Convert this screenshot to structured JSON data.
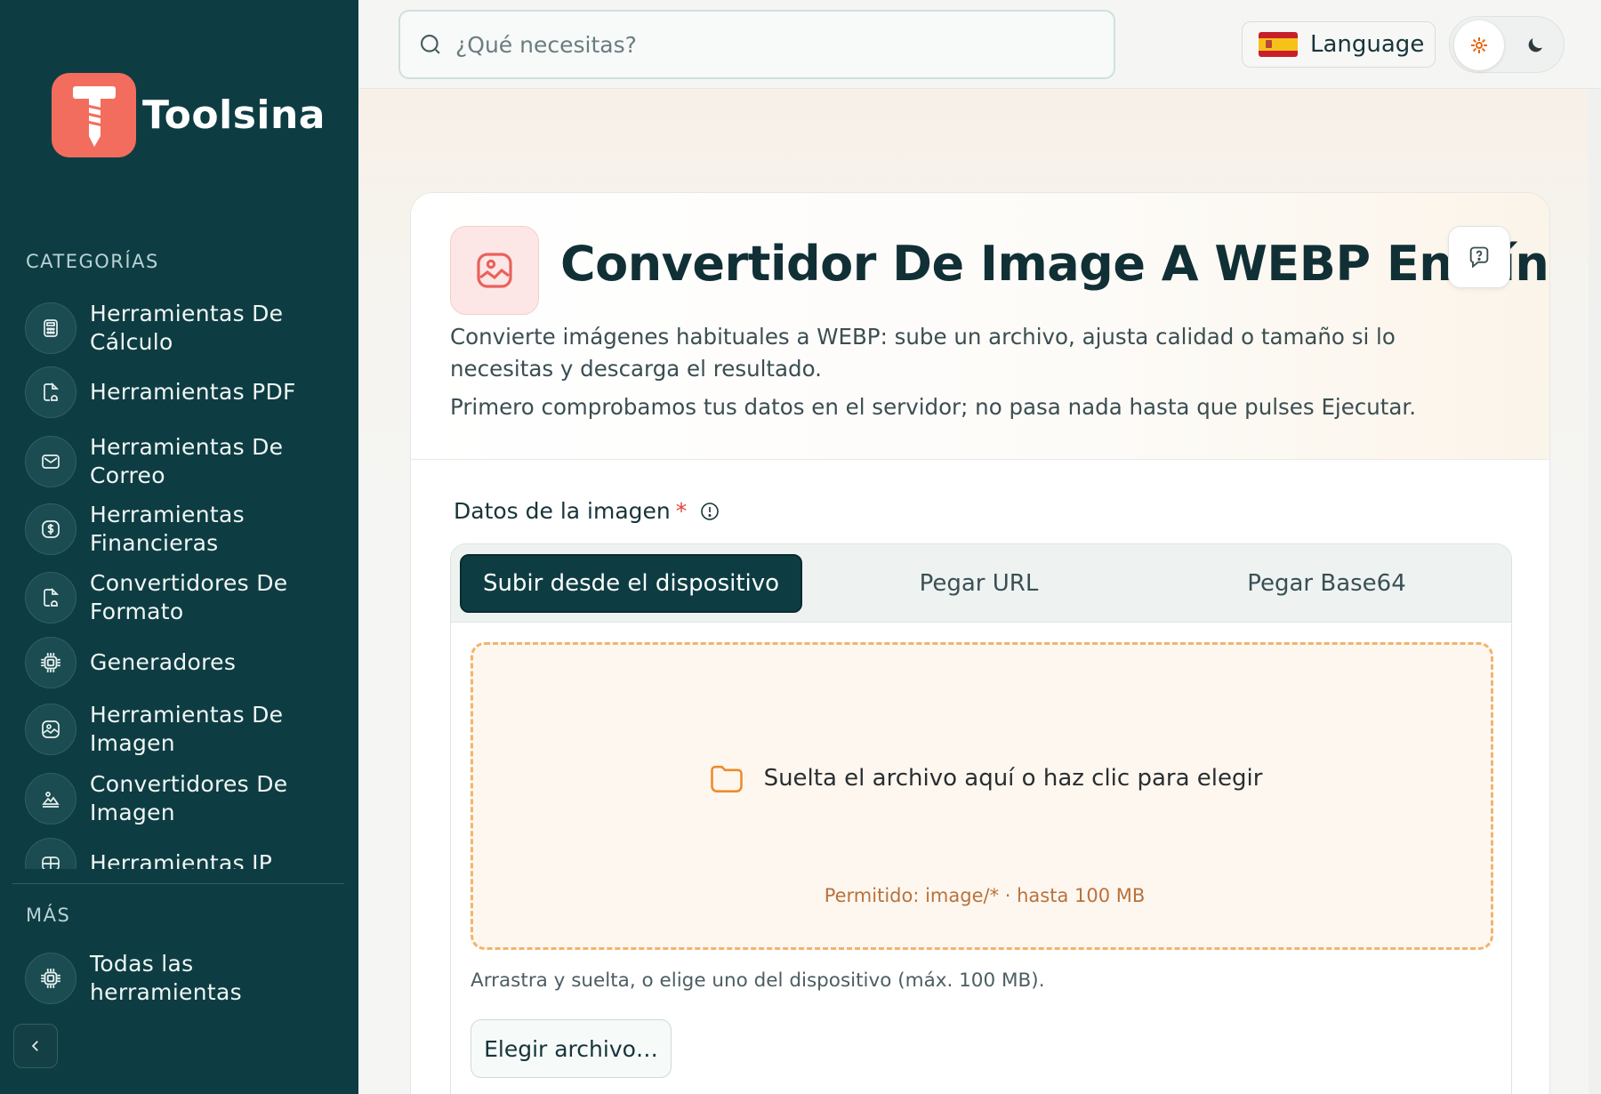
{
  "brand": {
    "name": "Toolsina",
    "color": "#f36d5e",
    "sidebar_bg": "#0d3d42"
  },
  "sidebar": {
    "categories_label": "CATEGORÍAS",
    "items": [
      {
        "label": "Herramientas De\nCálculo",
        "icon": "calculator-icon"
      },
      {
        "label": "Herramientas PDF",
        "icon": "pdf-icon"
      },
      {
        "label": "Herramientas De\nCorreo",
        "icon": "mail-icon"
      },
      {
        "label": "Herramientas\nFinancieras",
        "icon": "dollar-icon"
      },
      {
        "label": "Convertidores De\nFormato",
        "icon": "format-icon"
      },
      {
        "label": "Generadores",
        "icon": "chip-icon"
      },
      {
        "label": "Herramientas De\nImagen",
        "icon": "image-icon"
      },
      {
        "label": "Convertidores De\nImagen",
        "icon": "image-convert-icon"
      },
      {
        "label": "Herramientas IP",
        "icon": "network-icon"
      }
    ],
    "more_label": "MÁS",
    "more_items": [
      {
        "label": "Todas las\nherramientas",
        "icon": "chip-icon"
      }
    ]
  },
  "topbar": {
    "search_placeholder": "¿Qué necesitas?",
    "language_label": "Language"
  },
  "tool": {
    "title": "Convertidor De Image A WEBP En Línea",
    "description": "Convierte imágenes habituales a WEBP: sube un archivo, ajusta calidad o tamaño si lo necesitas y descarga el resultado.",
    "note": "Primero comprobamos tus datos en el servidor; no pasa nada hasta que pulses Ejecutar.",
    "field_label": "Datos de la imagen",
    "required_mark": "*",
    "tabs": [
      {
        "label": "Subir desde el dispositivo",
        "active": true
      },
      {
        "label": "Pegar URL",
        "active": false
      },
      {
        "label": "Pegar Base64",
        "active": false
      }
    ],
    "dropzone": {
      "main": "Suelta el archivo aquí o haz clic para elegir",
      "allowed": "Permitido: image/* · hasta 100 MB"
    },
    "hint": "Arrastra y suelta, o elige uno del dispositivo (máx. 100 MB).",
    "choose_button": "Elegir archivo…"
  }
}
